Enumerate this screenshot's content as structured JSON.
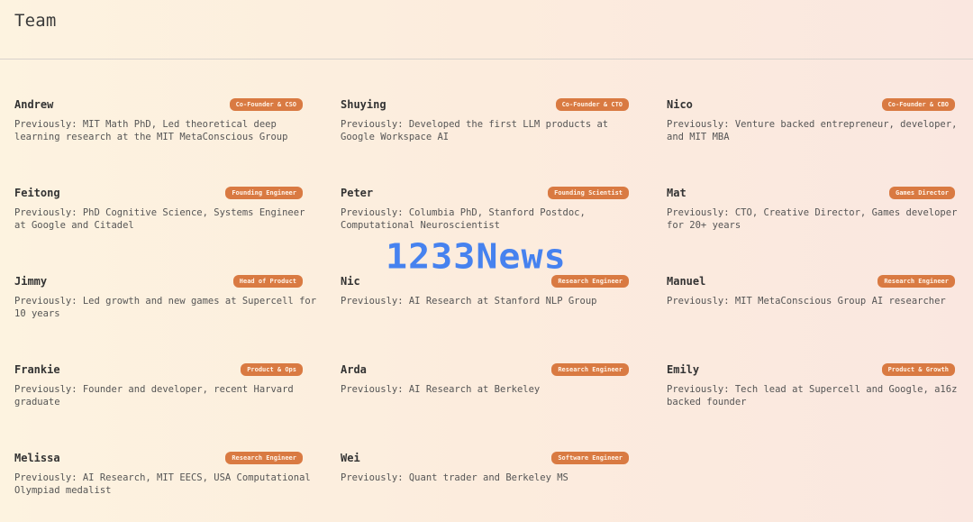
{
  "page": {
    "title": "Team"
  },
  "watermark": "1233News",
  "members": [
    {
      "name": "Andrew",
      "role": "Co-Founder & CSO",
      "bio": "Previously: MIT Math PhD, Led theoretical deep learning research at the MIT MetaConscious Group"
    },
    {
      "name": "Shuying",
      "role": "Co-Founder & CTO",
      "bio": "Previously: Developed the first LLM products at Google Workspace AI"
    },
    {
      "name": "Nico",
      "role": "Co-Founder & CBO",
      "bio": "Previously: Venture backed entrepreneur, developer, and MIT MBA"
    },
    {
      "name": "Feitong",
      "role": "Founding Engineer",
      "bio": "Previously: PhD Cognitive Science, Systems Engineer at Google and Citadel"
    },
    {
      "name": "Peter",
      "role": "Founding Scientist",
      "bio": "Previously: Columbia PhD, Stanford Postdoc, Computational Neuroscientist"
    },
    {
      "name": "Mat",
      "role": "Games Director",
      "bio": "Previously: CTO, Creative Director, Games developer for 20+ years"
    },
    {
      "name": "Jimmy",
      "role": "Head of Product",
      "bio": "Previously: Led growth and new games at Supercell for 10 years"
    },
    {
      "name": "Nic",
      "role": "Research Engineer",
      "bio": "Previously: AI Research at Stanford NLP Group"
    },
    {
      "name": "Manuel",
      "role": "Research Engineer",
      "bio": "Previously: MIT MetaConscious Group AI researcher"
    },
    {
      "name": "Frankie",
      "role": "Product & Ops",
      "bio": "Previously: Founder and developer, recent Harvard graduate"
    },
    {
      "name": "Arda",
      "role": "Research Engineer",
      "bio": "Previously: AI Research at Berkeley"
    },
    {
      "name": "Emily",
      "role": "Product & Growth",
      "bio": "Previously: Tech lead at Supercell and Google, a16z backed founder"
    },
    {
      "name": "Melissa",
      "role": "Research Engineer",
      "bio": "Previously: AI Research, MIT EECS, USA Computational Olympiad medalist"
    },
    {
      "name": "Wei",
      "role": "Software Engineer",
      "bio": "Previously: Quant trader and Berkeley MS"
    }
  ]
}
